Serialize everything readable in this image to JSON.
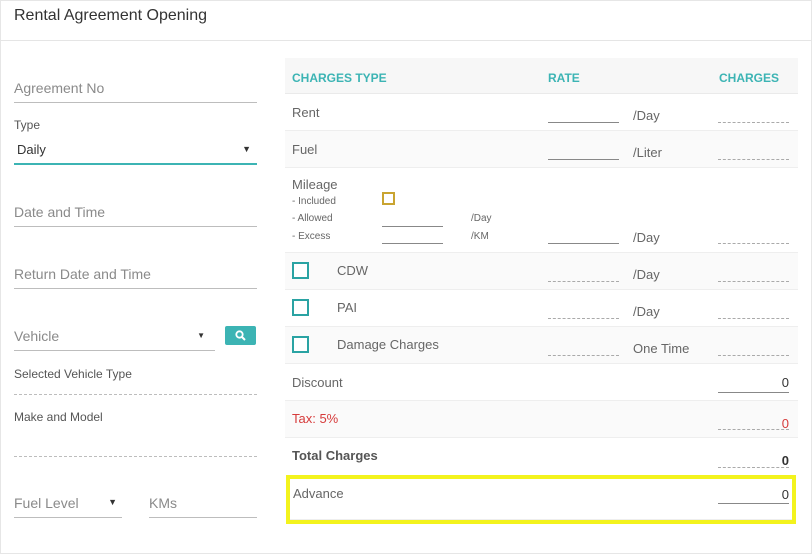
{
  "header": {
    "title": "Rental Agreement Opening"
  },
  "form": {
    "agreement_no_placeholder": "Agreement No",
    "type_label": "Type",
    "type_value": "Daily",
    "date_time_placeholder": "Date and Time",
    "return_date_placeholder": "Return Date and Time",
    "vehicle_placeholder": "Vehicle",
    "selected_vehicle_type_label": "Selected Vehicle Type",
    "make_model_label": "Make and Model",
    "fuel_level_placeholder": "Fuel Level",
    "kms_placeholder": "KMs"
  },
  "charges": {
    "headers": {
      "type": "CHARGES TYPE",
      "rate": "RATE",
      "charges": "CHARGES"
    },
    "rent": {
      "label": "Rent",
      "unit": "/Day"
    },
    "fuel": {
      "label": "Fuel",
      "unit": "/Liter"
    },
    "mileage": {
      "label": "Mileage",
      "included": "- Included",
      "allowed": "- Allowed",
      "excess": "- Excess",
      "allowed_unit": "/Day",
      "excess_unit": "/KM",
      "unit": "/Day"
    },
    "cdw": {
      "label": "CDW",
      "unit": "/Day"
    },
    "pai": {
      "label": "PAI",
      "unit": "/Day"
    },
    "damage": {
      "label": "Damage Charges",
      "unit": "One Time"
    },
    "discount": {
      "label": "Discount",
      "value": "0"
    },
    "tax": {
      "label": "Tax: 5%",
      "value": "0"
    },
    "total": {
      "label": "Total Charges",
      "value": "0"
    },
    "advance": {
      "label": "Advance",
      "value": "0"
    }
  },
  "colors": {
    "accent": "#3cb4b4",
    "highlight": "#f3f31d",
    "tax": "#d63b3b",
    "checkbox_gold": "#c9a431"
  },
  "icons": {
    "search": "search-icon",
    "type_caret": "chevron-down-icon"
  }
}
